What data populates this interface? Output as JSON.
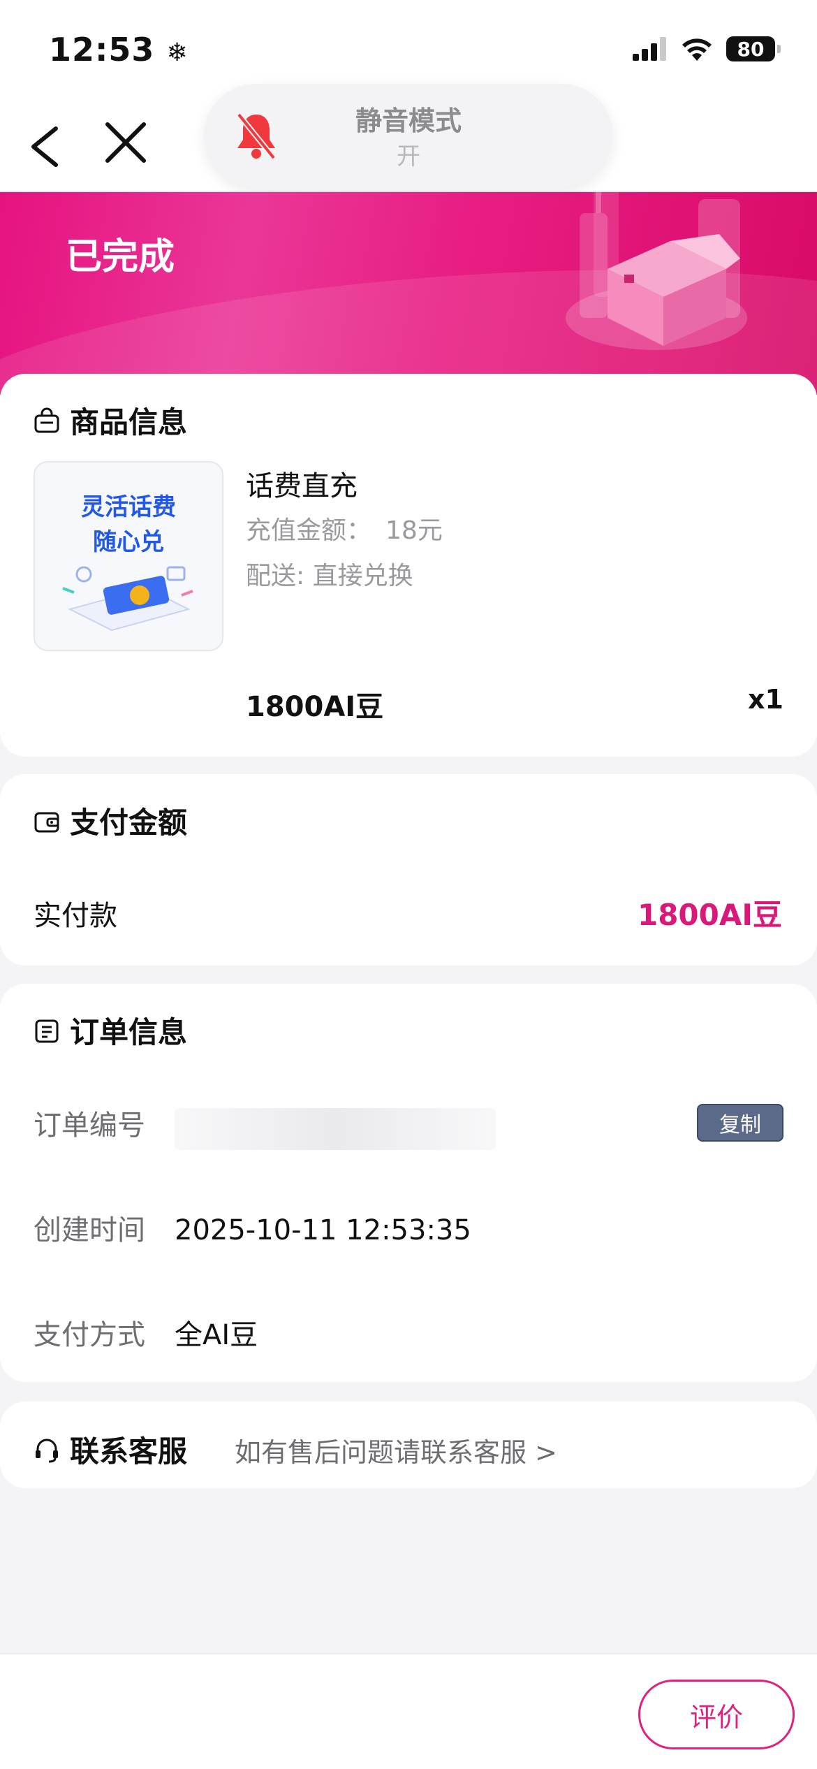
{
  "status_bar": {
    "time": "12:53",
    "battery": "80"
  },
  "silent_banner": {
    "title": "静音模式",
    "state": "开"
  },
  "order_status": "已完成",
  "product": {
    "section_title": "商品信息",
    "thumb_line1": "灵活话费",
    "thumb_line2": "随心兑",
    "name": "话费直充",
    "amount_label": "充值金额：",
    "amount_value": "18元",
    "delivery": "配送: 直接兑换",
    "price": "1800AI豆",
    "quantity": "x1"
  },
  "payment": {
    "section_title": "支付金额",
    "paid_label": "实付款",
    "paid_value": "1800AI豆",
    "accent_color": "#d8197a"
  },
  "order_info": {
    "section_title": "订单信息",
    "order_no_label": "订单编号",
    "copy_label": "复制",
    "created_label": "创建时间",
    "created_value": "2025-10-11 12:53:35",
    "pay_method_label": "支付方式",
    "pay_method_value": "全AI豆"
  },
  "service": {
    "title": "联系客服",
    "hint": "如有售后问题请联系客服 >"
  },
  "bottom": {
    "review_label": "评价"
  }
}
